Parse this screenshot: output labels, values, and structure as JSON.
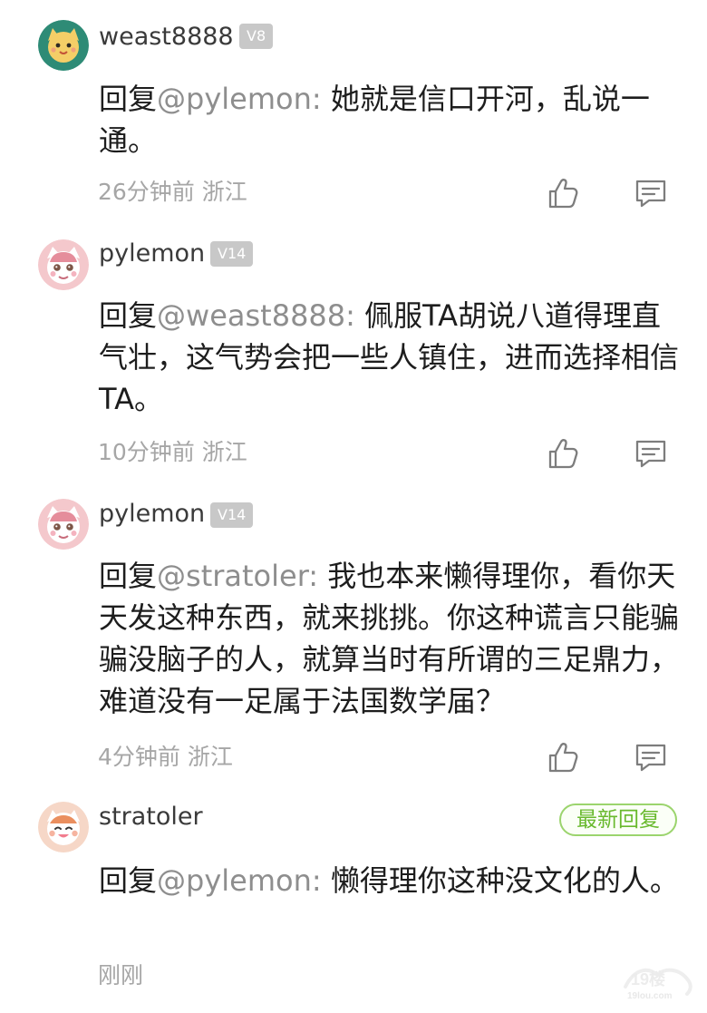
{
  "comments": [
    {
      "username": "weast8888",
      "level": "V8",
      "reply_prefix": "回复",
      "mention": "@pylemon:",
      "text": "她就是信口开河，乱说一通。",
      "time": "26分钟前",
      "location": "浙江",
      "avatar": "cat-avatar",
      "actions": [
        "thumb-up-icon",
        "comment-icon"
      ]
    },
    {
      "username": "pylemon",
      "level": "V14",
      "reply_prefix": "回复",
      "mention": "@weast8888:",
      "text": "佩服TA胡说八道得理直气壮，这气势会把一些人镇住，进而选择相信TA。",
      "time": "10分钟前",
      "location": "浙江",
      "avatar": "cat-girl-avatar",
      "actions": [
        "thumb-up-icon",
        "comment-icon"
      ]
    },
    {
      "username": "pylemon",
      "level": "V14",
      "reply_prefix": "回复",
      "mention": "@stratoler:",
      "text": "我也本来懒得理你，看你天天发这种东西，就来挑挑。你这种谎言只能骗骗没脑子的人，就算当时有所谓的三足鼎力，难道没有一足属于法国数学届？",
      "time": "4分钟前",
      "location": "浙江",
      "avatar": "cat-girl-avatar",
      "actions": [
        "thumb-up-icon",
        "comment-icon"
      ]
    },
    {
      "username": "stratoler",
      "badge": "最新回复",
      "reply_prefix": "回复",
      "mention": "@pylemon:",
      "text": "懒得理你这种没文化的人。",
      "time": "刚刚",
      "avatar": "smiling-cat-avatar"
    }
  ],
  "watermark": {
    "top": "19楼",
    "bottom": "19lou.com"
  },
  "colors": {
    "username": "#3a3a3a",
    "body": "#1d1d1d",
    "mention": "#8e8e8e",
    "meta": "#a6a6a6",
    "level_badge": "#c8c8c8",
    "new_reply_border": "#9bd46d",
    "new_reply_text": "#69b92e"
  }
}
